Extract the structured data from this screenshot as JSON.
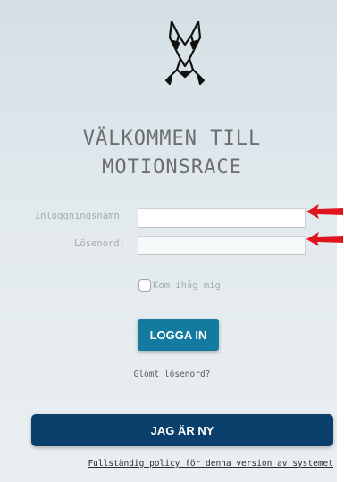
{
  "login": {
    "title_line1": "VÄLKOMMEN TILL",
    "title_line2": "MOTIONSRACE",
    "username_label": "Inloggningsnamn:",
    "username_value": "",
    "password_label": "Lösenord:",
    "password_value": "",
    "remember_label": "Kom ihåg mig",
    "remember_checked": false,
    "login_button": "LOGGA IN",
    "forgot_link": "Glömt lösenord?",
    "new_user_button": "JAG ÄR NY",
    "policy_link": "Fullständig policy för denna version av systemet"
  },
  "icons": {
    "logo": "wolf-head-logo-icon",
    "arrow": "red-arrow-pointer-icon"
  },
  "colors": {
    "login_button": "#137aa0",
    "new_user_button": "#0b3f6b",
    "arrow": "#e0141c",
    "title_text": "#6a6f73"
  }
}
